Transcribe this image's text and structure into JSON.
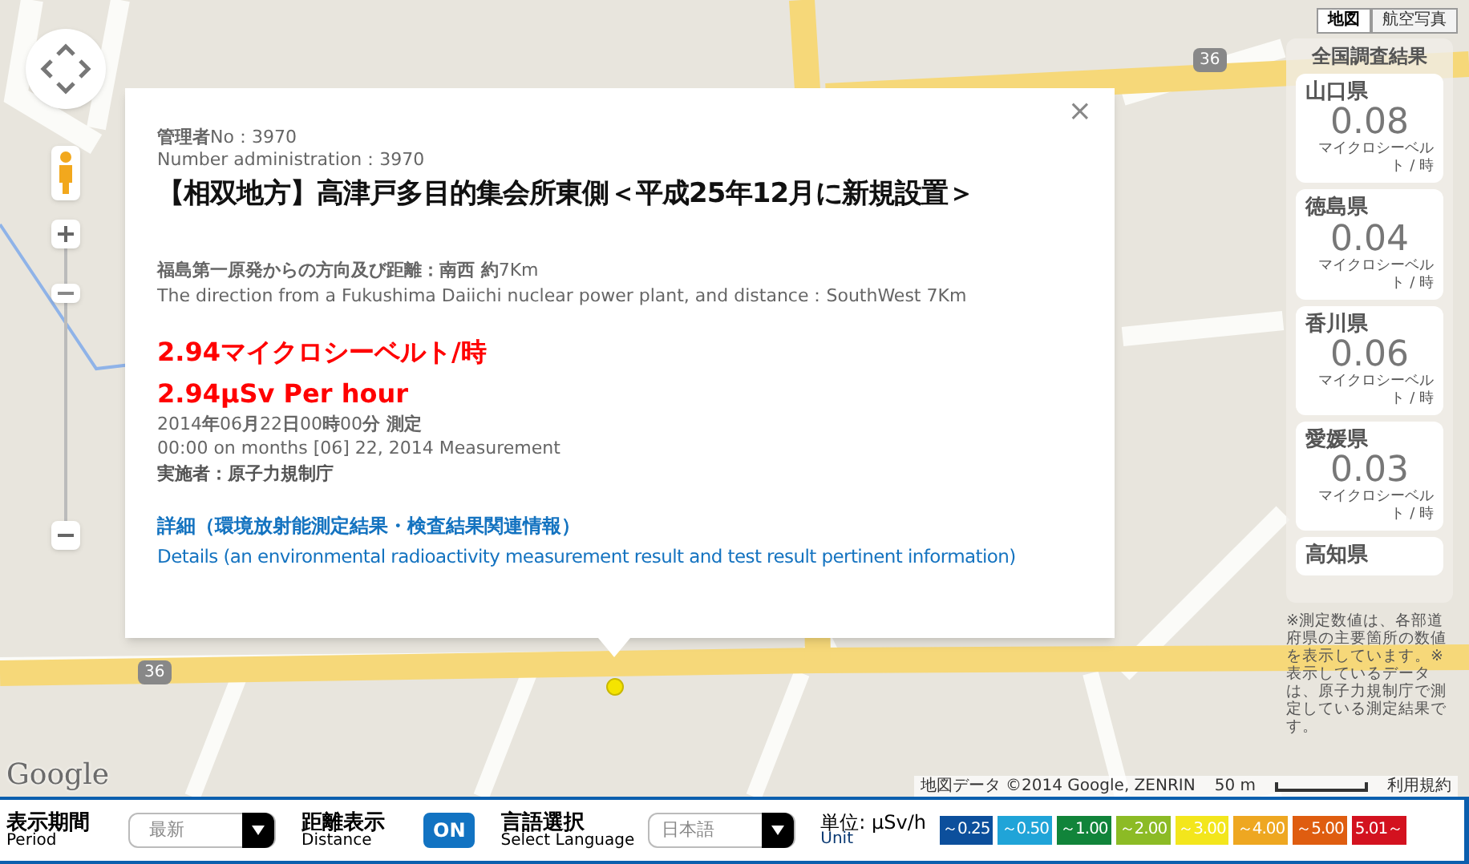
{
  "map": {
    "road_labels": [
      "36",
      "36"
    ],
    "logo": "Google",
    "attribution": "地図データ ©2014 Google, ZENRIN",
    "scale": "50 m",
    "terms": "利用規約"
  },
  "map_type_buttons": [
    {
      "label": "地図",
      "selected": true
    },
    {
      "label": "航空写真",
      "selected": false
    }
  ],
  "survey_panel": {
    "title": "全国調査結果",
    "prefectures": [
      {
        "name": "山口県",
        "value": "0.08",
        "unit": "マイクロシーベルト / 時"
      },
      {
        "name": "徳島県",
        "value": "0.04",
        "unit": "マイクロシーベルト / 時"
      },
      {
        "name": "香川県",
        "value": "0.06",
        "unit": "マイクロシーベルト / 時"
      },
      {
        "name": "愛媛県",
        "value": "0.03",
        "unit": "マイクロシーベルト / 時"
      },
      {
        "name": "高知県"
      }
    ],
    "notes": "※測定数値は、各部道府県の主要箇所の数値を表示しています。※表示しているデータは、原子力規制庁で測定している測定結果です。"
  },
  "popup": {
    "close": "×",
    "admin_no_ja": "**管理者**No：3970",
    "admin_no_en": "Number administration：3970",
    "title": "【相双地方】高津戸多目的集会所東側＜平成25年12月に新規設置＞",
    "direction_ja": "**福島第一原発からの方向及び距離：南西 約**7Km",
    "direction_en": "The direction from a Fukushima Daiichi nuclear power plant, and distance：SouthWest 7Km",
    "dose_ja": "2.94マイクロシーベルト/時",
    "dose_en": "2.94μSv Per hour",
    "measured_ja": "2014**年**06**月**22**日**00**時**00**分 測定**",
    "measured_en": "00:00 on months [06] 22, 2014 Measurement",
    "agency": "実施者：原子力規制庁",
    "details_ja": "詳細（環境放射能測定結果・検査結果関連情報）",
    "details_en": "Details (an environmental radioactivity measurement result and test result pertinent information)"
  },
  "bottom_bar": {
    "period": {
      "label": "表示期間",
      "sublabel": "Period",
      "value": "最新"
    },
    "distance": {
      "label": "距離表示",
      "sublabel": "Distance",
      "toggle": "ON",
      "on": true
    },
    "language": {
      "label": "言語選択",
      "sublabel": "Select Language",
      "value": "日本語"
    },
    "unit": {
      "label": "単位: μSv/h",
      "sublabel": "Unit"
    },
    "legend": [
      {
        "label": "～0.25",
        "color": "#0c4f9c"
      },
      {
        "label": "～0.50",
        "color": "#20a4d8"
      },
      {
        "label": "～1.00",
        "color": "#11843a"
      },
      {
        "label": "～2.00",
        "color": "#8cbb25"
      },
      {
        "label": "～3.00",
        "color": "#f3e61c"
      },
      {
        "label": "～4.00",
        "color": "#eea721"
      },
      {
        "label": "～5.00",
        "color": "#df5d10"
      },
      {
        "label": "5.01～",
        "color": "#d3121f"
      }
    ]
  }
}
